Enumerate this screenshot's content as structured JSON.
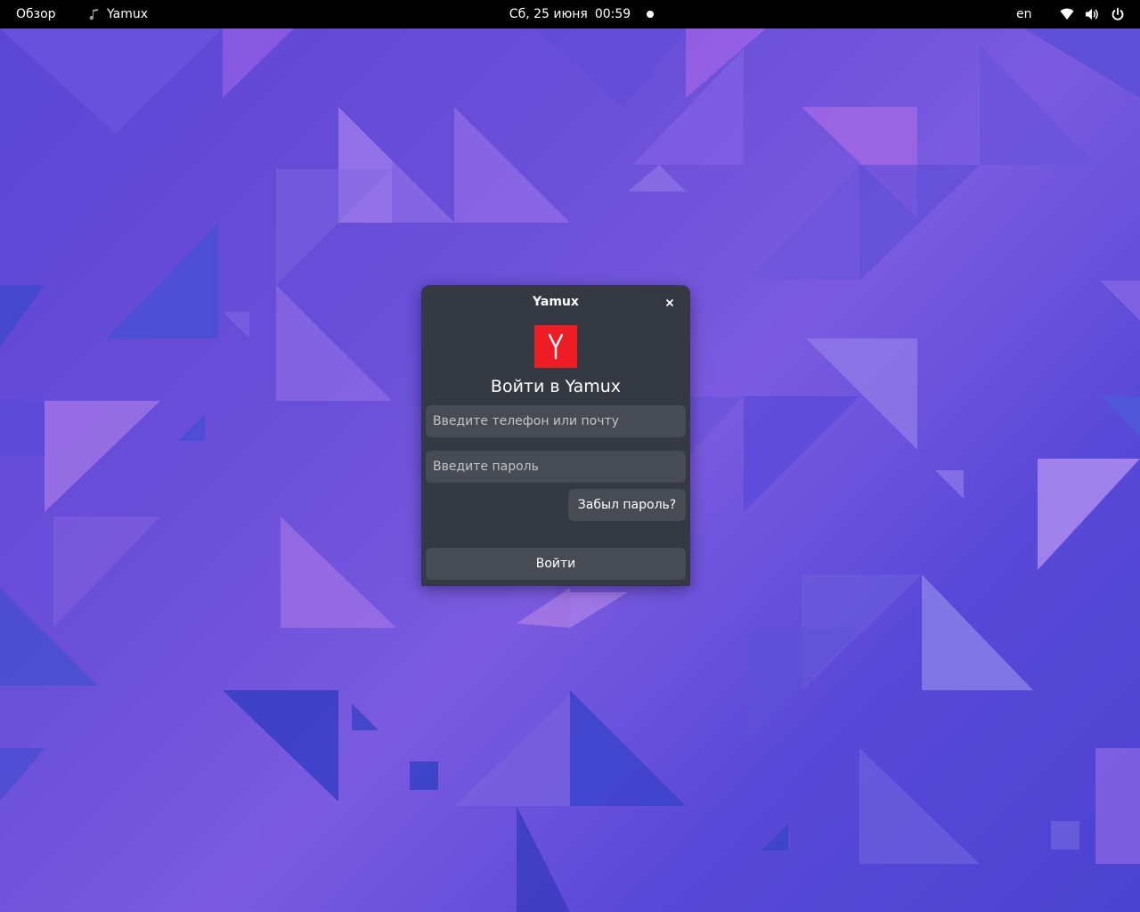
{
  "topbar": {
    "activities": "Обзор",
    "app_name": "Yamux",
    "app_icon": "music-note-icon",
    "date": "Сб, 25 июня",
    "time": "00:59",
    "language": "en",
    "tray_icons": [
      "wifi-icon",
      "volume-icon",
      "power-icon"
    ]
  },
  "dialog": {
    "title": "Yamux",
    "logo_letter": "Y",
    "heading": "Войти в Yamux",
    "login_placeholder": "Введите телефон или почту",
    "password_placeholder": "Введите пароль",
    "forgot_label": "Забыл пароль?",
    "login_label": "Войти"
  },
  "colors": {
    "topbar": "#000000",
    "dialog_bg": "#353a42",
    "field_bg": "#474b53",
    "logo_red": "#ee1c25",
    "wallpaper": "#5b46d6"
  }
}
